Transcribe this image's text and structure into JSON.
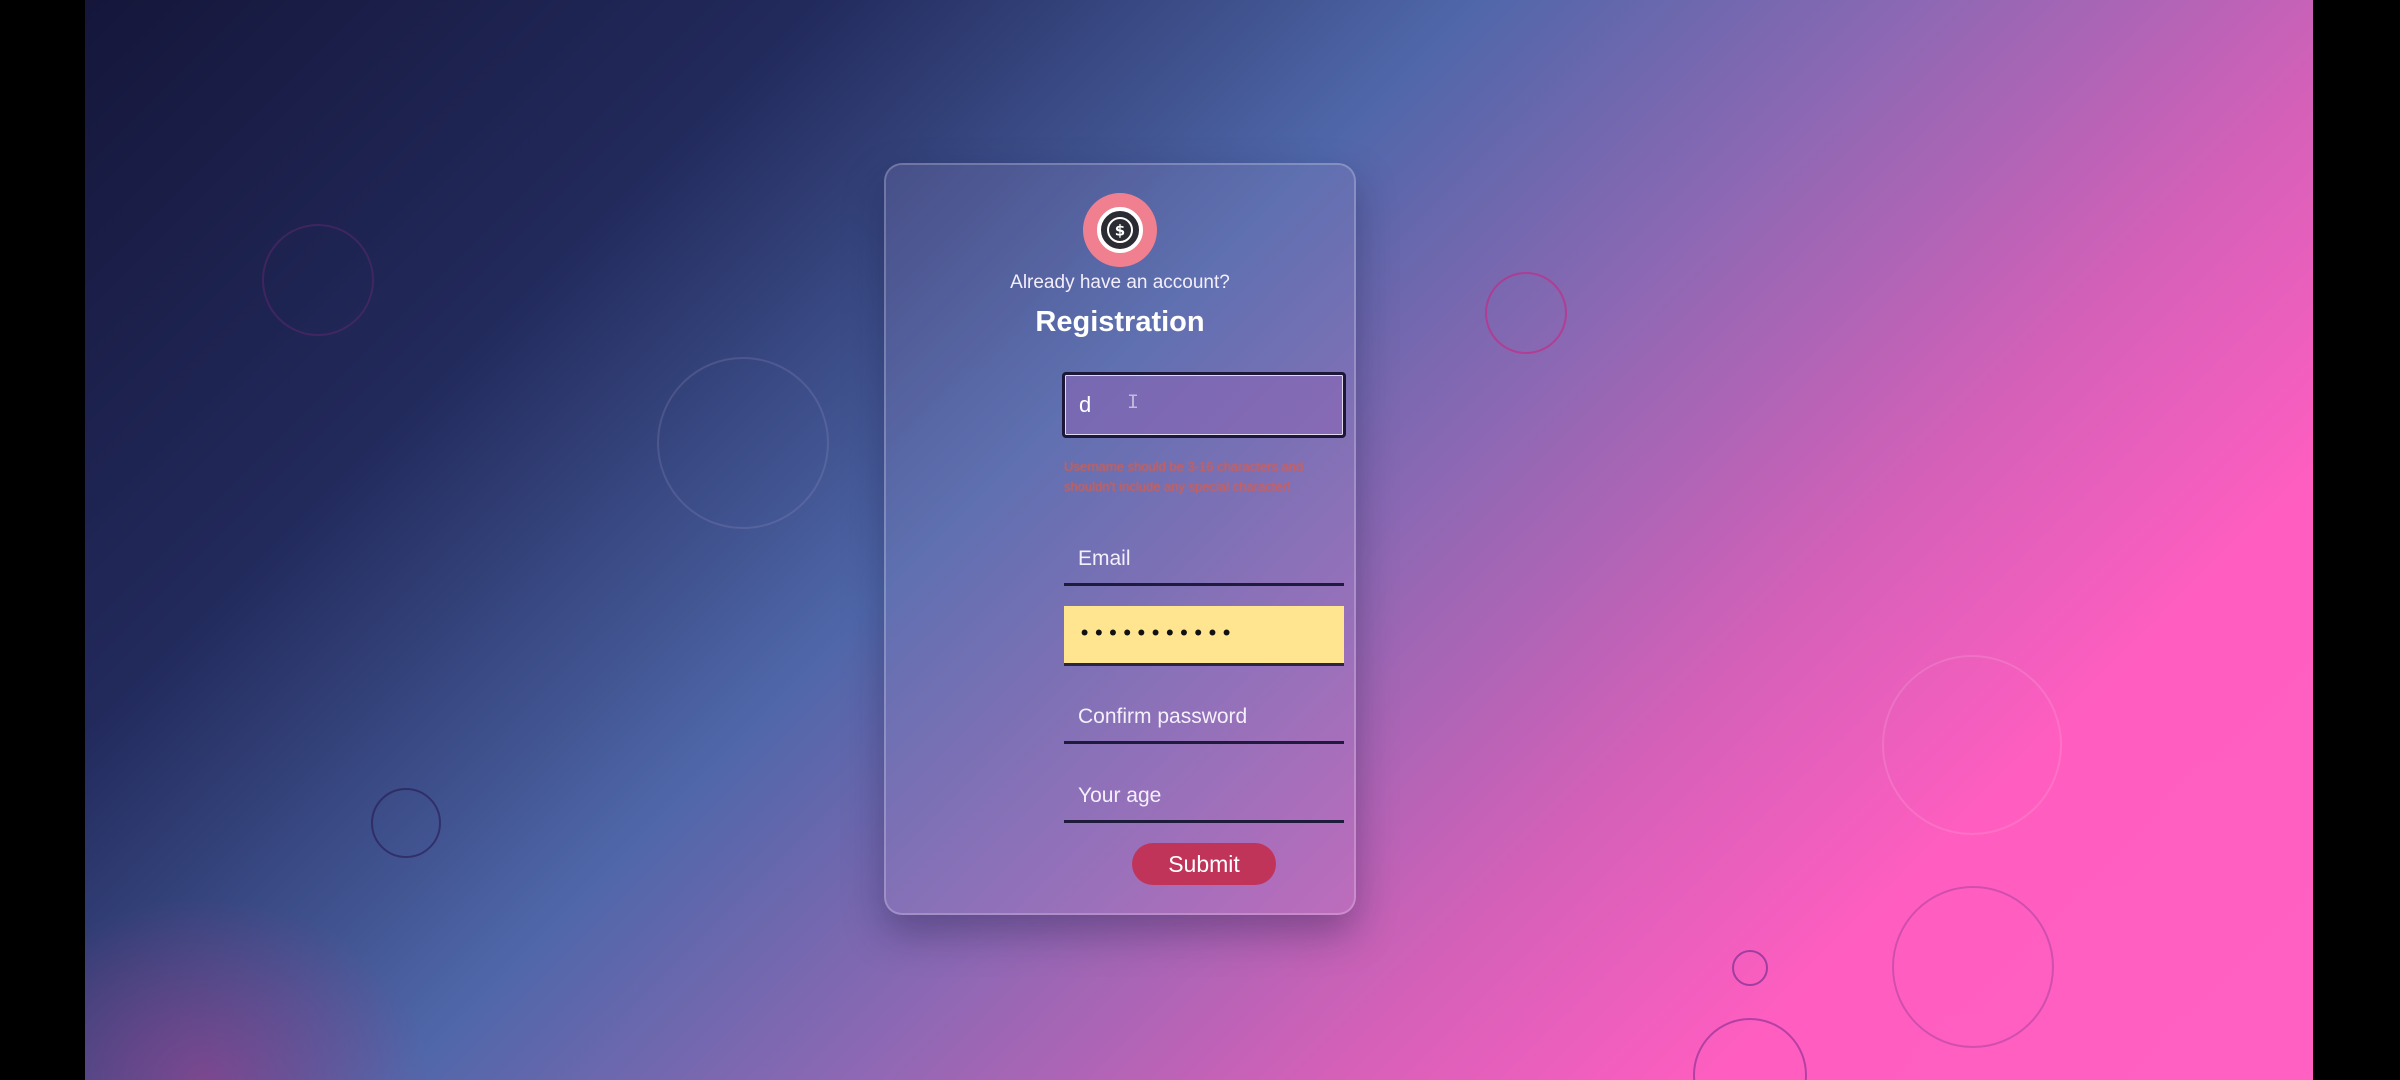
{
  "form": {
    "logo_icon": "dollar-coin-icon",
    "login_prompt": "Already have an account?",
    "title": "Registration",
    "username_value": "d",
    "username_error": "Username should be 3-16 characters and shouldn't include any special character!",
    "email_placeholder": "Email",
    "password_value": "•••••••••••",
    "confirm_password_placeholder": "Confirm password",
    "age_placeholder": "Your age",
    "submit_label": "Submit"
  },
  "colors": {
    "accent": "#c0345a",
    "logo_ring": "#f08090",
    "autofill_bg": "#ffe590",
    "error": "#e8593a"
  }
}
